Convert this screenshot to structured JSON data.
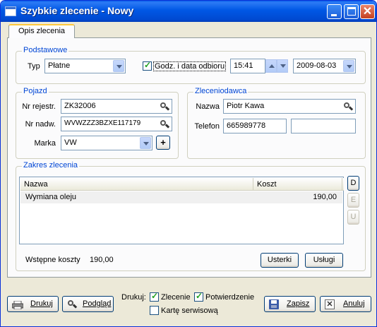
{
  "window": {
    "title": "Szybkie zlecenie - Nowy"
  },
  "tabs": [
    {
      "label": "Opis zlecenia"
    }
  ],
  "basic": {
    "legend": "Podstawowe",
    "type_label": "Typ",
    "type_value": "Płatne",
    "pickup_checkbox_label": "Godz. i data odbioru",
    "pickup_checked": true,
    "time_value": "15:41",
    "date_value": "2009-08-03"
  },
  "vehicle": {
    "legend": "Pojazd",
    "reg_label": "Nr rejestr.",
    "reg_value": "ZK32006",
    "vin_label": "Nr nadw.",
    "vin_value": "WVWZZZ3BZXE117179",
    "make_label": "Marka",
    "make_value": "VW",
    "add_button": "+"
  },
  "client": {
    "legend": "Zleceniodawca",
    "name_label": "Nazwa",
    "name_value": "Piotr Kawa",
    "phone_label": "Telefon",
    "phone_value": "665989778",
    "phone2_value": ""
  },
  "scope": {
    "legend": "Zakres zlecenia",
    "columns": [
      "Nazwa",
      "Koszt"
    ],
    "rows": [
      {
        "name": "Wymiana oleju",
        "cost": "190,00"
      }
    ],
    "side_buttons": [
      "D",
      "E",
      "U"
    ],
    "initial_cost_label": "Wstępne koszty",
    "initial_cost_value": "190,00",
    "defects_button": "Usterki",
    "services_button": "Usługi"
  },
  "footer": {
    "print_button": "Drukuj",
    "preview_button": "Podgląd",
    "print_label": "Drukuj:",
    "opt_order": "Zlecenie",
    "opt_order_checked": true,
    "opt_confirmation": "Potwierdzenie",
    "opt_confirmation_checked": true,
    "opt_service_card": "Kartę serwisową",
    "opt_service_card_checked": false,
    "save_button": "Zapisz",
    "cancel_button": "Anuluj"
  }
}
